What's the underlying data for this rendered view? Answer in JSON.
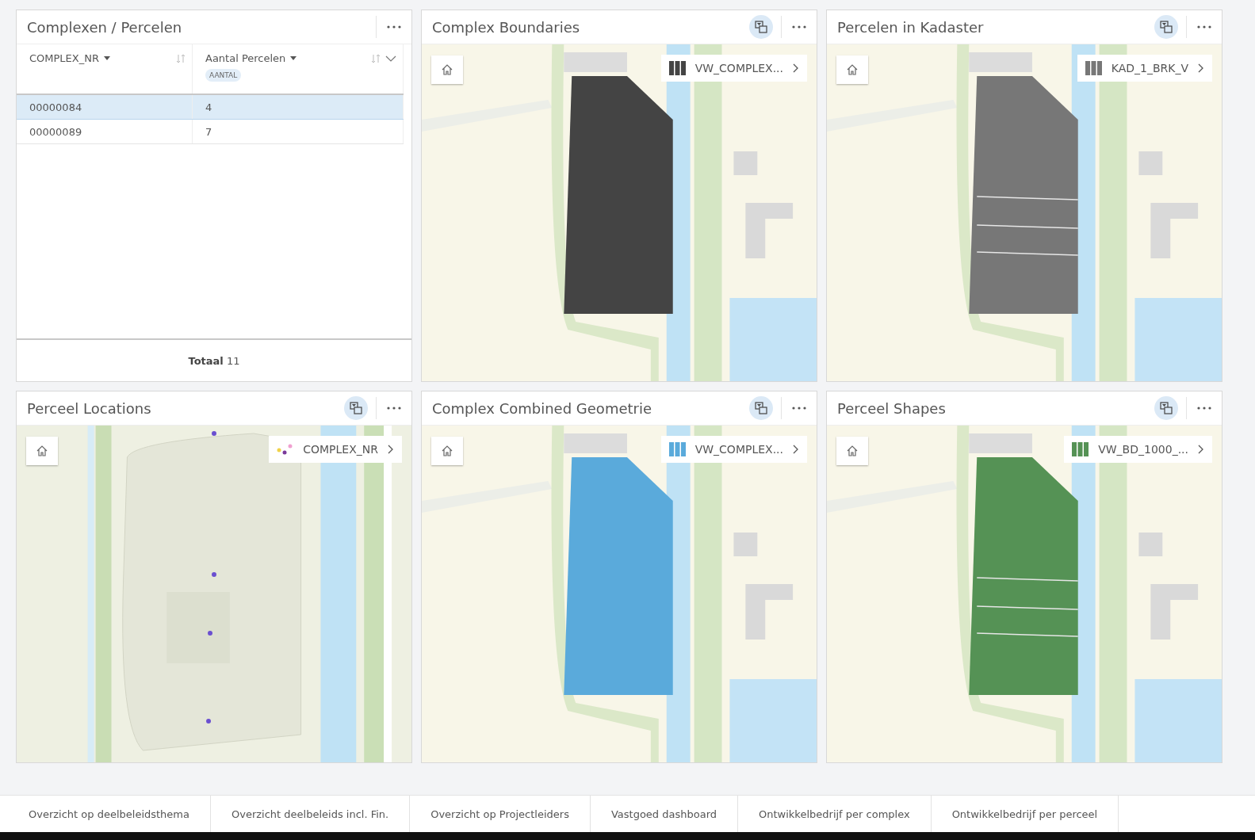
{
  "panels": [
    {
      "kind": "table",
      "title": "Complexen / Percelen",
      "table": {
        "columns": [
          {
            "label": "COMPLEX_NR"
          },
          {
            "label": "Aantal Percelen",
            "badge": "AANTAL"
          }
        ],
        "rows": [
          {
            "cells": [
              "00000084",
              "4"
            ],
            "selected": true
          },
          {
            "cells": [
              "00000089",
              "7"
            ],
            "selected": false
          }
        ],
        "footer": "**Totaal** 11"
      }
    },
    {
      "kind": "map",
      "title": "Complex Boundaries",
      "legend": {
        "label": "VW_COMPLEX...",
        "kind": "bars",
        "color": "#444444"
      },
      "map": {
        "kind": "polygon"
      }
    },
    {
      "kind": "map",
      "title": "Percelen in Kadaster",
      "legend": {
        "label": "KAD_1_BRK_V",
        "kind": "bars",
        "color": "#777777"
      },
      "map": {
        "kind": "parcels"
      }
    },
    {
      "kind": "map",
      "title": "Perceel Locations",
      "legend": {
        "label": "COMPLEX_NR",
        "kind": "dots"
      },
      "map": {
        "kind": "points"
      }
    },
    {
      "kind": "map",
      "title": "Complex Combined Geometrie",
      "legend": {
        "label": "VW_COMPLEX...",
        "kind": "bars",
        "color": "#5aaadb"
      },
      "map": {
        "kind": "polygon"
      }
    },
    {
      "kind": "map",
      "title": "Perceel Shapes",
      "legend": {
        "label": "VW_BD_1000_...",
        "kind": "bars",
        "color": "#559255"
      },
      "map": {
        "kind": "parcels"
      }
    }
  ],
  "tabs": [
    {
      "label": "Overzicht op deelbeleidsthema"
    },
    {
      "label": "Overzicht deelbeleids incl. Fin."
    },
    {
      "label": "Overzicht op Projectleiders"
    },
    {
      "label": "Vastgoed dashboard"
    },
    {
      "label": "Ontwikkelbedrijf per complex"
    },
    {
      "label": "Ontwikkelbedrijf per perceel"
    }
  ]
}
